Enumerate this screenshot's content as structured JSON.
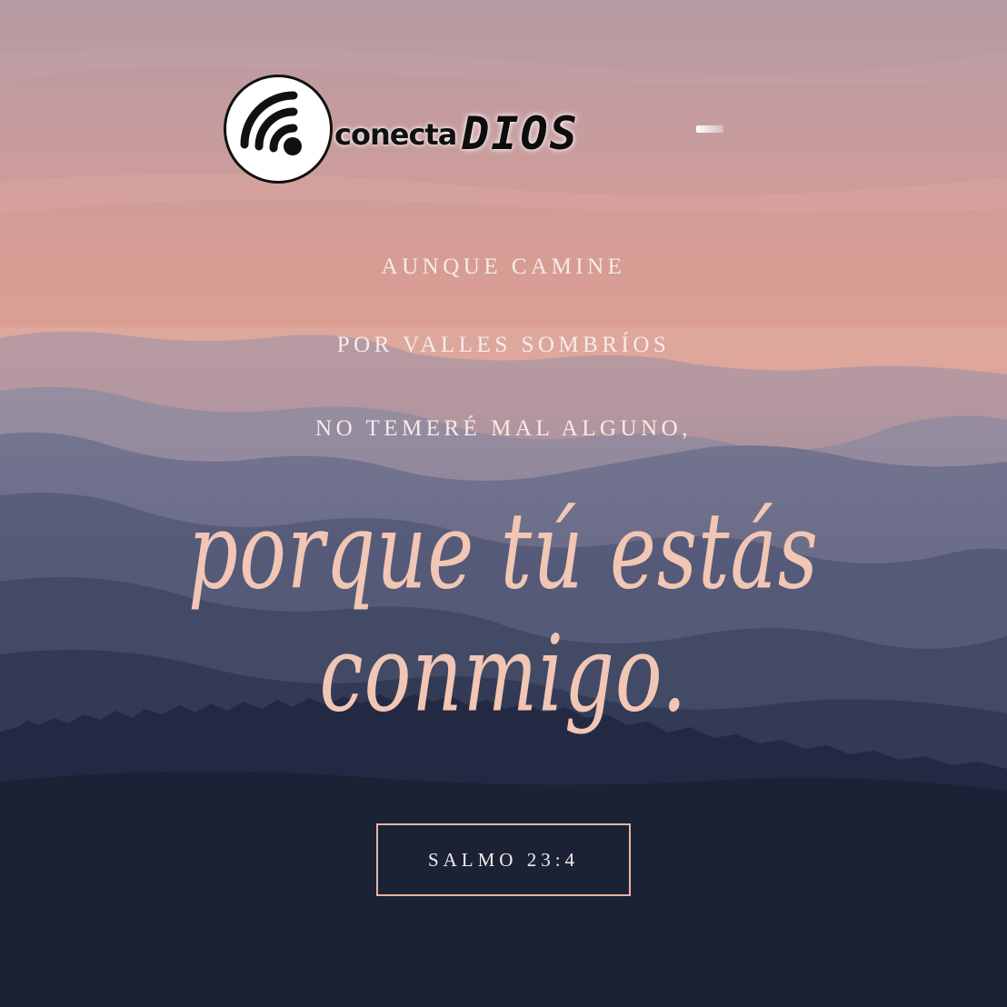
{
  "logo": {
    "icon": "wifi-signal-icon",
    "word_a": "conecta",
    "word_b": "DIOS"
  },
  "verse": {
    "line1": "AUNQUE CAMINE",
    "line2": "POR VALLES SOMBRÍOS",
    "line3": "NO TEMERÉ MAL ALGUNO,",
    "script_line": "porque tú estás conmigo."
  },
  "reference": "SALMO 23:4",
  "colors": {
    "sky_top": "#b79a9f",
    "sky_mid": "#d99b93",
    "mountains_far": "#7a7b96",
    "mountains_near": "#1b2133",
    "script_text": "#f2c6b4",
    "frame_border": "#e7b4a6"
  }
}
